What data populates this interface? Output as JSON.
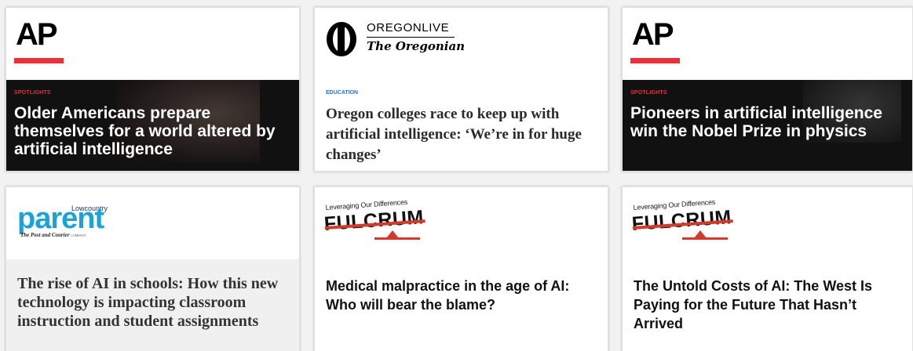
{
  "cards": [
    {
      "publisher": "AP",
      "category": "SPOTLIGHTS",
      "headline": "Older Americans prepare themselves for a world altered by artificial intelligence"
    },
    {
      "publisher": "OREGONLIVE",
      "publisher_sub": "The Oregonian",
      "logo_mark": "O",
      "category": "EDUCATION",
      "headline": "Oregon colleges race to keep up with artificial intelligence: ‘We’re in for huge changes’"
    },
    {
      "publisher": "AP",
      "category": "SPOTLIGHTS",
      "headline": "Pioneers in artificial intelligence win the Nobel Prize in physics"
    },
    {
      "publisher": "parent",
      "publisher_top": "Lowcountry",
      "publisher_sub": "The Post and Courier",
      "publisher_sub_tag": "COMPANY",
      "headline": "The rise of AI in schools: How this new technology is impacting classroom instruction and student assignments"
    },
    {
      "publisher": "FULCRUM",
      "tagline": "Leveraging Our Differences",
      "headline": "Medical malpractice in the age of AI: Who will bear the blame?"
    },
    {
      "publisher": "FULCRUM",
      "tagline": "Leveraging Our Differences",
      "headline": "The Untold Costs of AI: The West Is Paying for the Future That Hasn’t Arrived"
    }
  ],
  "colors": {
    "ap_red": "#e8313a",
    "education_blue": "#2a6fd6",
    "parent_blue": "#1ba3d9",
    "fulcrum_red": "#d23a2c"
  },
  "icons": {
    "ap": "ap-logo",
    "oregonlive": "oregonian-o-mark-icon",
    "fulcrum": "fulcrum-scale-icon"
  }
}
